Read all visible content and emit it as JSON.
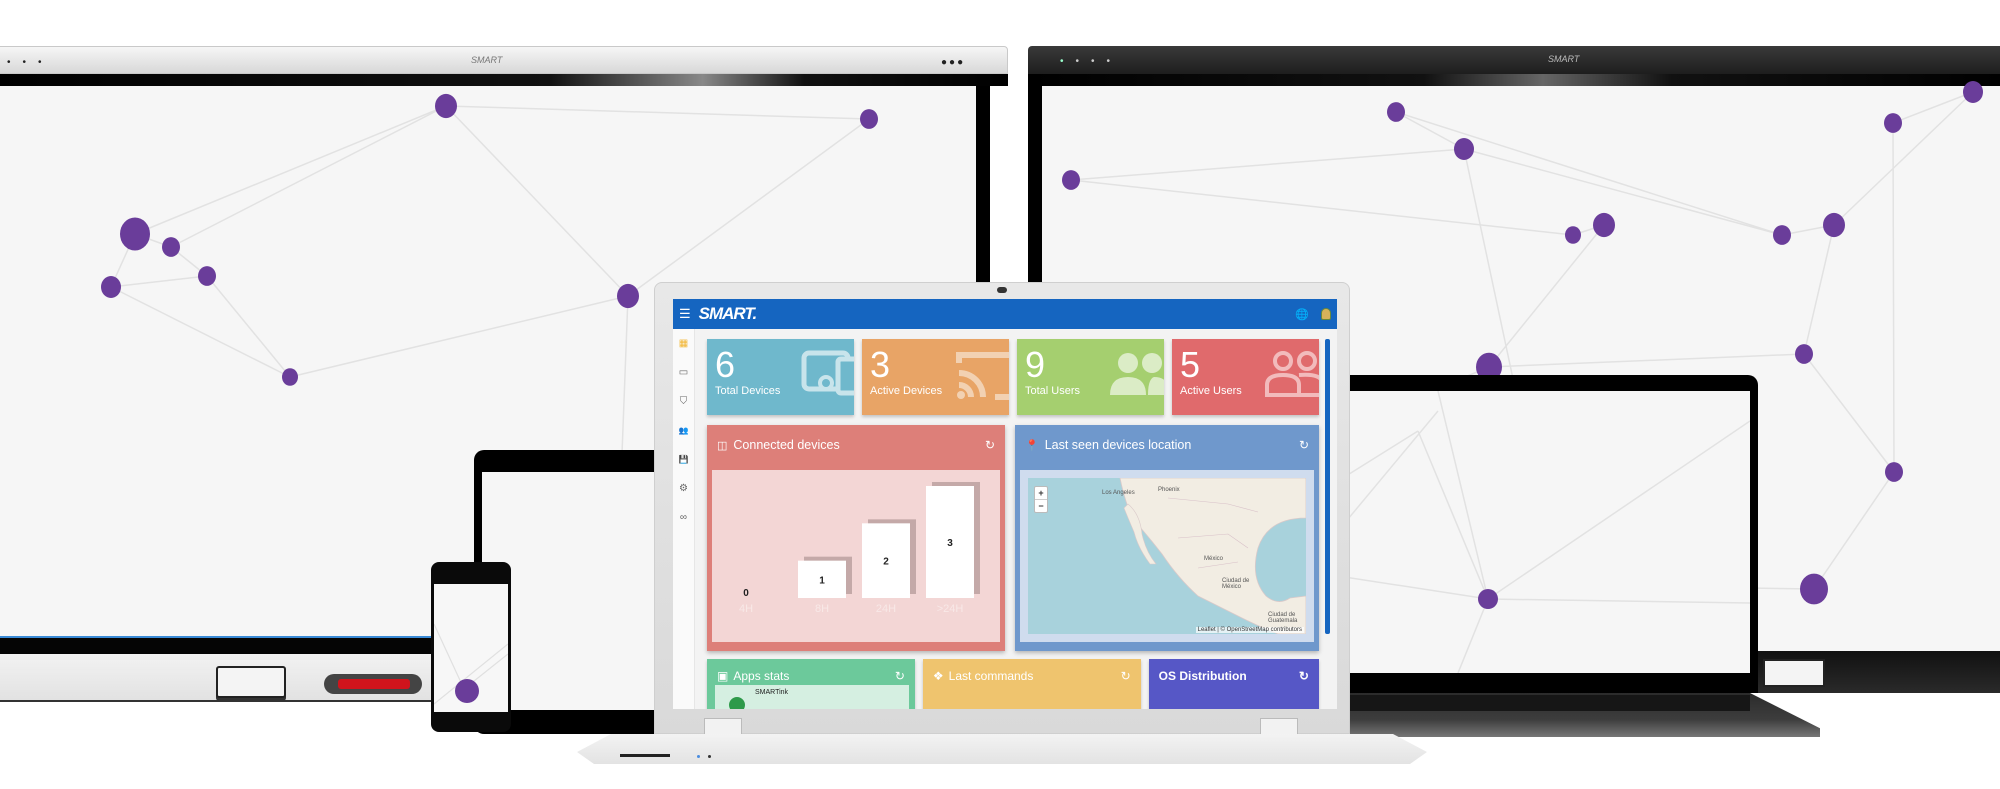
{
  "scene": {
    "description": "SMART device management dashboard shown on a laptop among whiteboards, tablet, phone and MacBook",
    "display_brand": "SMART",
    "node_color": "#6a3d9a"
  },
  "app": {
    "logo": "SMART.",
    "menu_icon": "hamburger-icon",
    "header_icons": [
      "globe-icon",
      "user-avatar"
    ],
    "brand_color": "#1565c0"
  },
  "sidebar": {
    "items": [
      {
        "icon": "dashboard-icon",
        "glyph": "▦",
        "active": true
      },
      {
        "icon": "devices-icon",
        "glyph": "▭"
      },
      {
        "icon": "shield-check-icon",
        "glyph": "⛉"
      },
      {
        "icon": "users-icon",
        "glyph": "👥"
      },
      {
        "icon": "save-icon",
        "glyph": "💾"
      },
      {
        "icon": "settings-group-icon",
        "glyph": "⚙"
      },
      {
        "icon": "link-icon",
        "glyph": "∞"
      }
    ]
  },
  "stats": [
    {
      "value": "6",
      "label": "Total Devices",
      "color": "#6fb8cc",
      "icon": "devices-icon",
      "glyph": "▭"
    },
    {
      "value": "3",
      "label": "Active Devices",
      "color": "#e8a466",
      "icon": "cast-icon",
      "glyph": "◸"
    },
    {
      "value": "9",
      "label": "Total Users",
      "color": "#a5cf6f",
      "icon": "users-icon",
      "glyph": "●●"
    },
    {
      "value": "5",
      "label": "Active Users",
      "color": "#e06a6c",
      "icon": "users-outline-icon",
      "glyph": "○○"
    }
  ],
  "connected_devices": {
    "title": "Connected devices",
    "refresh_glyph": "↻",
    "chart_data": {
      "type": "bar",
      "title": "Connected devices",
      "categories": [
        "4H",
        "8H",
        "24H",
        ">24H"
      ],
      "values": [
        0,
        1,
        2,
        3
      ],
      "xlabel": "",
      "ylabel": "",
      "ylim": [
        0,
        3
      ],
      "grid": false
    }
  },
  "location": {
    "title": "Last seen devices location",
    "refresh_glyph": "↻",
    "zoom_in": "+",
    "zoom_out": "−",
    "cities": [
      "Los Angeles",
      "Phoenix",
      "México",
      "Ciudad de México",
      "Ciudad de Guatemala"
    ],
    "attribution": "Leaflet | © OpenStreetMap contributors"
  },
  "bottom_panels": {
    "apps": {
      "title": "Apps stats",
      "first_app": "SMARTink",
      "refresh_glyph": "↻"
    },
    "commands": {
      "title": "Last commands",
      "refresh_glyph": "↻"
    },
    "os": {
      "title": "OS Distribution",
      "refresh_glyph": "↻"
    }
  }
}
